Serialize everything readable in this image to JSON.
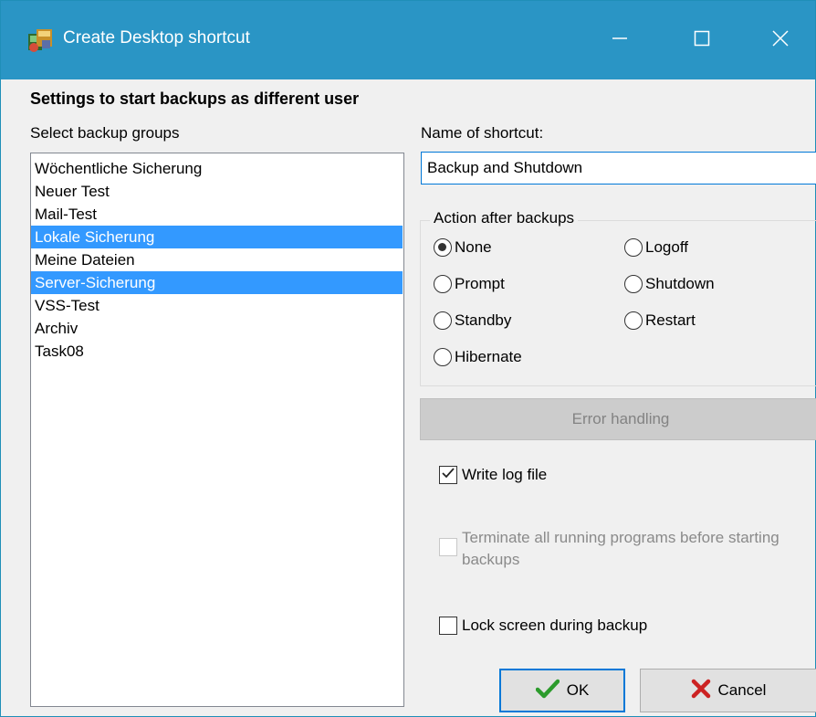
{
  "window": {
    "title": "Create Desktop shortcut",
    "icons": {
      "app": "shortcut-app-icon",
      "minimize": "minimize-icon",
      "maximize": "maximize-icon",
      "close": "close-icon"
    },
    "accent_color": "#2a95c5"
  },
  "heading": "Settings to start backups as different user",
  "groups": {
    "label": "Select backup groups",
    "items": [
      {
        "label": "Wöchentliche Sicherung",
        "selected": false
      },
      {
        "label": "Neuer Test",
        "selected": false
      },
      {
        "label": "Mail-Test",
        "selected": false
      },
      {
        "label": "Lokale Sicherung",
        "selected": true
      },
      {
        "label": "Meine Dateien",
        "selected": false
      },
      {
        "label": "Server-Sicherung",
        "selected": true
      },
      {
        "label": "VSS-Test",
        "selected": false
      },
      {
        "label": "Archiv",
        "selected": false
      },
      {
        "label": "Task08",
        "selected": false
      }
    ],
    "selection_color": "#3399ff"
  },
  "shortcut_name": {
    "label": "Name of shortcut:",
    "value": "Backup and Shutdown"
  },
  "action_after_backups": {
    "legend": "Action after backups",
    "selected": "None",
    "options": [
      "None",
      "Prompt",
      "Standby",
      "Hibernate",
      "Logoff",
      "Shutdown",
      "Restart"
    ]
  },
  "error_handling": {
    "label": "Error handling",
    "enabled": false
  },
  "options": {
    "write_log": {
      "label": "Write log file",
      "checked": true,
      "enabled": true
    },
    "terminate_programs": {
      "label": "Terminate all running programs before starting backups",
      "checked": false,
      "enabled": false
    },
    "lock_screen": {
      "label": "Lock screen during backup",
      "checked": false,
      "enabled": true
    }
  },
  "buttons": {
    "ok": {
      "label": "OK",
      "icon": "checkmark-icon",
      "color": "#2c9b2c"
    },
    "cancel": {
      "label": "Cancel",
      "icon": "x-mark-icon",
      "color": "#cc2222"
    }
  }
}
